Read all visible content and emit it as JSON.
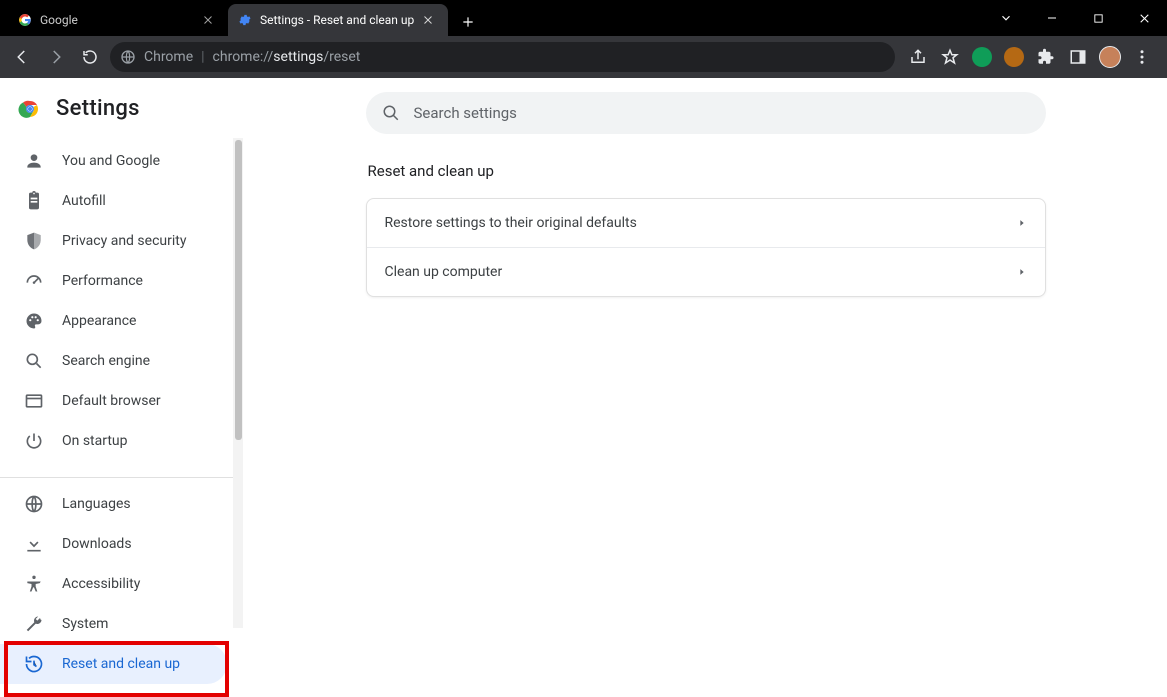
{
  "window": {
    "tabs": [
      {
        "title": "Google",
        "active": false
      },
      {
        "title": "Settings - Reset and clean up",
        "active": true
      }
    ]
  },
  "addressbar": {
    "chip": "Chrome",
    "prefix": "chrome://",
    "bold": "settings",
    "suffix": "/reset"
  },
  "settings": {
    "title": "Settings",
    "search_placeholder": "Search settings",
    "nav_groups": [
      [
        {
          "label": "You and Google",
          "icon": "person-icon"
        },
        {
          "label": "Autofill",
          "icon": "clipboard-icon"
        },
        {
          "label": "Privacy and security",
          "icon": "shield-icon"
        },
        {
          "label": "Performance",
          "icon": "speed-icon"
        },
        {
          "label": "Appearance",
          "icon": "palette-icon"
        },
        {
          "label": "Search engine",
          "icon": "search-icon"
        },
        {
          "label": "Default browser",
          "icon": "browser-icon"
        },
        {
          "label": "On startup",
          "icon": "power-icon"
        }
      ],
      [
        {
          "label": "Languages",
          "icon": "globe-icon"
        },
        {
          "label": "Downloads",
          "icon": "download-icon"
        },
        {
          "label": "Accessibility",
          "icon": "accessibility-icon"
        },
        {
          "label": "System",
          "icon": "wrench-icon"
        },
        {
          "label": "Reset and clean up",
          "icon": "restore-icon",
          "selected": true
        }
      ]
    ]
  },
  "page": {
    "heading": "Reset and clean up",
    "rows": [
      "Restore settings to their original defaults",
      "Clean up computer"
    ]
  }
}
